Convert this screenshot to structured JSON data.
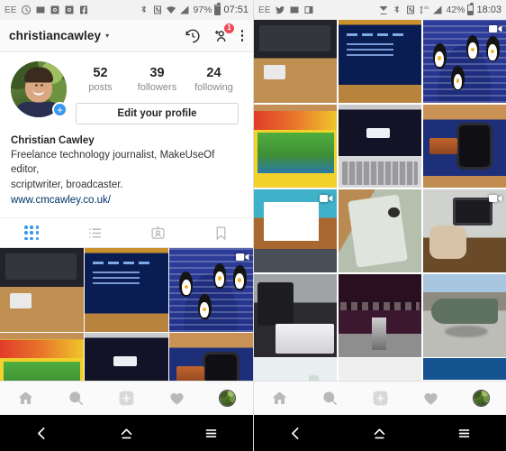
{
  "left_phone": {
    "statusbar": {
      "carrier": "EE",
      "left_icons": [
        "clock-icon",
        "image-icon",
        "instagram-icon",
        "instagram-icon",
        "facebook-icon"
      ],
      "right_icons": [
        "bluetooth-icon",
        "nfc-icon",
        "wifi-icon",
        "signal-icon"
      ],
      "battery_pct": "97%",
      "time": "07:51"
    },
    "header": {
      "username": "christiancawley",
      "caret": "▾",
      "history_icon": "history-icon",
      "add_person_icon": "add-person-icon",
      "badge_count": "1",
      "overflow_icon": "overflow-menu-icon"
    },
    "profile": {
      "avatar_plus": "+",
      "stats": [
        {
          "num": "52",
          "label": "posts"
        },
        {
          "num": "39",
          "label": "followers"
        },
        {
          "num": "24",
          "label": "following"
        }
      ],
      "edit_label": "Edit your profile"
    },
    "bio": {
      "name": "Christian Cawley",
      "line1": "Freelance technology journalist, MakeUseOf editor,",
      "line2": "scriptwriter, broadcaster.",
      "link": "www.cmcawley.co.uk/"
    },
    "tabs": [
      {
        "name": "grid-tab",
        "icon": "grid-icon",
        "active": true
      },
      {
        "name": "list-tab",
        "icon": "list-icon",
        "active": false
      },
      {
        "name": "tagged-tab",
        "icon": "person-tag-icon",
        "active": false
      },
      {
        "name": "saved-tab",
        "icon": "bookmark-icon",
        "active": false
      }
    ],
    "grid": [
      {
        "art": "ph-monitor",
        "overlay": null
      },
      {
        "art": "ph-bsod",
        "overlay": null
      },
      {
        "art": "ph-peng",
        "overlay": "video-icon"
      },
      {
        "art": "ph-commodore",
        "overlay": null
      },
      {
        "art": "ph-mac",
        "overlay": null
      },
      {
        "art": "ph-watch",
        "overlay": null
      }
    ],
    "bottom_nav": [
      {
        "name": "home-nav",
        "icon": "home-icon"
      },
      {
        "name": "search-nav",
        "icon": "search-icon"
      },
      {
        "name": "add-post-nav",
        "icon": "plus-square-icon"
      },
      {
        "name": "activity-nav",
        "icon": "heart-icon"
      },
      {
        "name": "profile-nav",
        "icon": "avatar-icon"
      }
    ]
  },
  "right_phone": {
    "statusbar": {
      "carrier": "EE",
      "left_icons": [
        "twitter-icon",
        "image-icon",
        "picture-in-picture-icon"
      ],
      "right_icons": [
        "download-icon",
        "bluetooth-icon",
        "nfc-icon",
        "data-4g-icon",
        "signal-icon"
      ],
      "battery_pct": "42%",
      "time": "18:03"
    },
    "grid": [
      {
        "art": "ph-monitor",
        "overlay": null
      },
      {
        "art": "ph-bsod",
        "overlay": null
      },
      {
        "art": "ph-peng",
        "overlay": "video-icon"
      },
      {
        "art": "ph-commodore",
        "overlay": null
      },
      {
        "art": "ph-mac",
        "overlay": null
      },
      {
        "art": "ph-watch",
        "overlay": null
      },
      {
        "art": "ph-paper",
        "overlay": "video-icon"
      },
      {
        "art": "ph-rpi",
        "overlay": null
      },
      {
        "art": "ph-snes",
        "overlay": "video-icon"
      },
      {
        "art": "ph-muo",
        "overlay": null
      },
      {
        "art": "ph-dark",
        "overlay": null
      },
      {
        "art": "ph-jet",
        "overlay": null
      },
      {
        "art": "ph-glass",
        "overlay": null
      },
      {
        "art": "ph-water",
        "overlay": null
      },
      {
        "art": "ph-table",
        "overlay": null
      }
    ],
    "bottom_nav": [
      {
        "name": "home-nav",
        "icon": "home-icon"
      },
      {
        "name": "search-nav",
        "icon": "search-icon"
      },
      {
        "name": "add-post-nav",
        "icon": "plus-square-icon"
      },
      {
        "name": "activity-nav",
        "icon": "heart-icon"
      },
      {
        "name": "profile-nav",
        "icon": "avatar-icon"
      }
    ]
  },
  "android_nav": {
    "back": "back-icon",
    "home": "home-icon",
    "recents": "recents-icon"
  }
}
